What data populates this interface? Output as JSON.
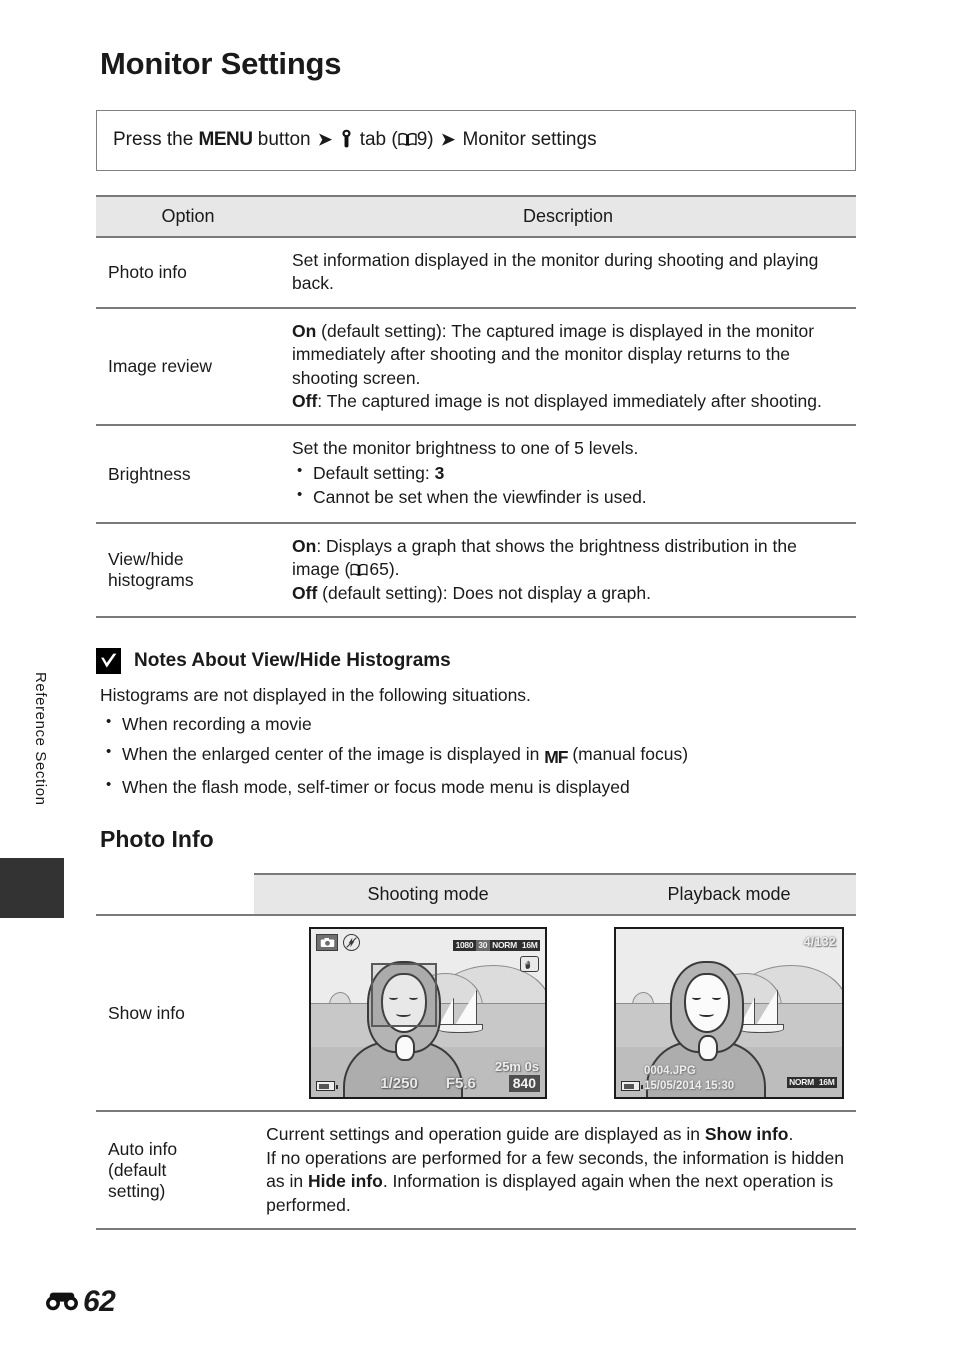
{
  "page": {
    "title": "Monitor Settings",
    "section_label": "Reference Section",
    "page_number": "62",
    "page_prefix_icon": "reference-section-E-icon"
  },
  "menu_path": {
    "prefix": "Press the",
    "menu_button": "MENU",
    "mid": "button",
    "arrow": "➔",
    "tab_icon": "wrench-setup-tab-icon",
    "tab_word": "tab",
    "ref_open": "(",
    "book_icon": "book-reference-icon",
    "ref_page": "9)",
    "destination": "Monitor settings"
  },
  "options_table": {
    "headers": [
      "Option",
      "Description"
    ],
    "rows": [
      {
        "option": "Photo info",
        "lines": [
          {
            "text": "Set information displayed in the monitor during shooting and playing back."
          }
        ]
      },
      {
        "option": "Image review",
        "lines": [
          {
            "bold": "On",
            "text": " (default setting): The captured image is displayed in the monitor immediately after shooting and the monitor display returns to the shooting screen."
          },
          {
            "bold": "Off",
            "text": ": The captured image is not displayed immediately after shooting."
          }
        ]
      },
      {
        "option": "Brightness",
        "lines": [
          {
            "text": "Set the monitor brightness to one of 5 levels."
          }
        ],
        "bullets": [
          {
            "text": "Default setting: ",
            "bold_tail": "3"
          },
          {
            "text": "Cannot be set when the viewfinder is used."
          }
        ]
      },
      {
        "option": "View/hide histograms",
        "lines": [
          {
            "bold": "On",
            "text": ": Displays a graph that shows the brightness distribution in the image (",
            "book_icon": true,
            "after": "65)."
          },
          {
            "bold": "Off",
            "text": " (default setting): Does not display a graph."
          }
        ]
      }
    ]
  },
  "note": {
    "icon": "caution-check-icon",
    "heading": "Notes About View/Hide Histograms",
    "lead": "Histograms are not displayed in the following situations.",
    "items": [
      {
        "text": "When recording a movie"
      },
      {
        "text": "When the enlarged center of the image is displayed in ",
        "icon": "MF",
        "tail": " (manual focus)"
      },
      {
        "text": "When the flash mode, self-timer or focus mode menu is displayed"
      }
    ]
  },
  "photo_info": {
    "title": "Photo Info",
    "headers": [
      "",
      "Shooting mode",
      "Playback mode"
    ],
    "rows": [
      {
        "option": "Show info",
        "type": "screens"
      },
      {
        "option": "Auto info (default setting)",
        "option_lines": [
          "Auto info",
          "(default",
          "setting)"
        ],
        "type": "text",
        "paragraphs": [
          {
            "pre": "Current settings and operation guide are displayed as in ",
            "bold": "Show info",
            "post": "."
          },
          {
            "pre": "If no operations are performed for a few seconds, the information is hidden as in ",
            "bold": "Hide info",
            "post": ". Information is displayed again when the next operation is performed."
          }
        ]
      }
    ]
  },
  "shooting_screen": {
    "mode_icon": "camera-auto-mode-icon",
    "flash_icon": "flash-off-icon",
    "movie_size": "1080",
    "frame_rate": "30",
    "quality": "NORM",
    "image_size": "16M",
    "vr_icon": "vibration-reduction-hand-icon",
    "battery_icon": "battery-icon",
    "shutter_speed": "1/250",
    "aperture": "F5.6",
    "movie_remaining": "25m 0s",
    "shots_remaining": "840"
  },
  "playback_screen": {
    "frame_counter": "4/132",
    "file_name": "0004.JPG",
    "date_time": "15/05/2014  15:30",
    "quality": "NORM",
    "image_size": "16M",
    "battery_icon": "battery-icon"
  }
}
